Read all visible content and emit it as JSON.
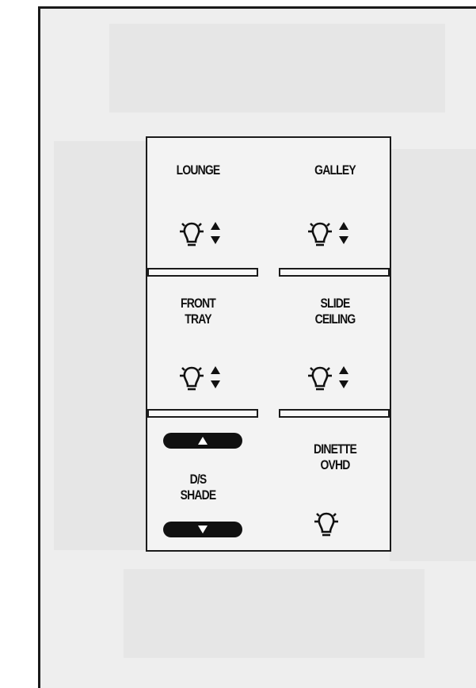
{
  "buttons": {
    "lounge": "LOUNGE",
    "galley": "GALLEY",
    "front_tray": [
      "FRONT",
      "TRAY"
    ],
    "slide_ceiling": [
      "SLIDE",
      "CEILING"
    ],
    "ds_shade": [
      "D/S",
      "SHADE"
    ],
    "dinette_ovhd": [
      "DINETTE",
      "OVHD"
    ]
  },
  "icons": {
    "dimmable_light": "light-bulb-with-up-down-arrows",
    "light": "light-bulb",
    "shade_up": "up-arrow",
    "shade_down": "down-arrow"
  },
  "colors": {
    "panel_border": "#1a1a1a",
    "panel_bg": "#f3f3f3",
    "pill": "#111111"
  }
}
